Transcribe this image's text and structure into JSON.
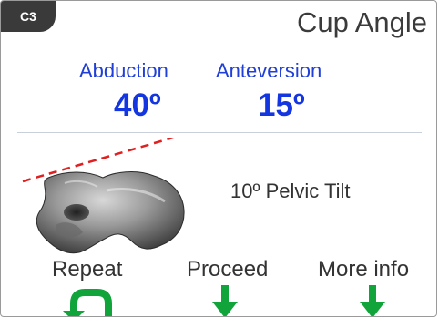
{
  "header": {
    "badge": "C3",
    "title": "Cup Angle"
  },
  "angles": {
    "abduction": {
      "label": "Abduction",
      "value": "40º"
    },
    "anteversion": {
      "label": "Anteversion",
      "value": "15º"
    }
  },
  "pelvic_tilt": {
    "text": "10º Pelvic Tilt"
  },
  "actions": {
    "repeat": "Repeat",
    "proceed": "Proceed",
    "more_info": "More info"
  },
  "colors": {
    "accent_blue": "#1436e0",
    "arrow_green": "#11a43a",
    "tilt_line_red": "#e02020",
    "badge_dark": "#3a3a3a"
  },
  "icons": {
    "pelvis": "pelvis-model-icon",
    "repeat": "repeat-arrow-icon",
    "proceed": "down-arrow-icon",
    "more_info": "down-arrow-icon"
  }
}
